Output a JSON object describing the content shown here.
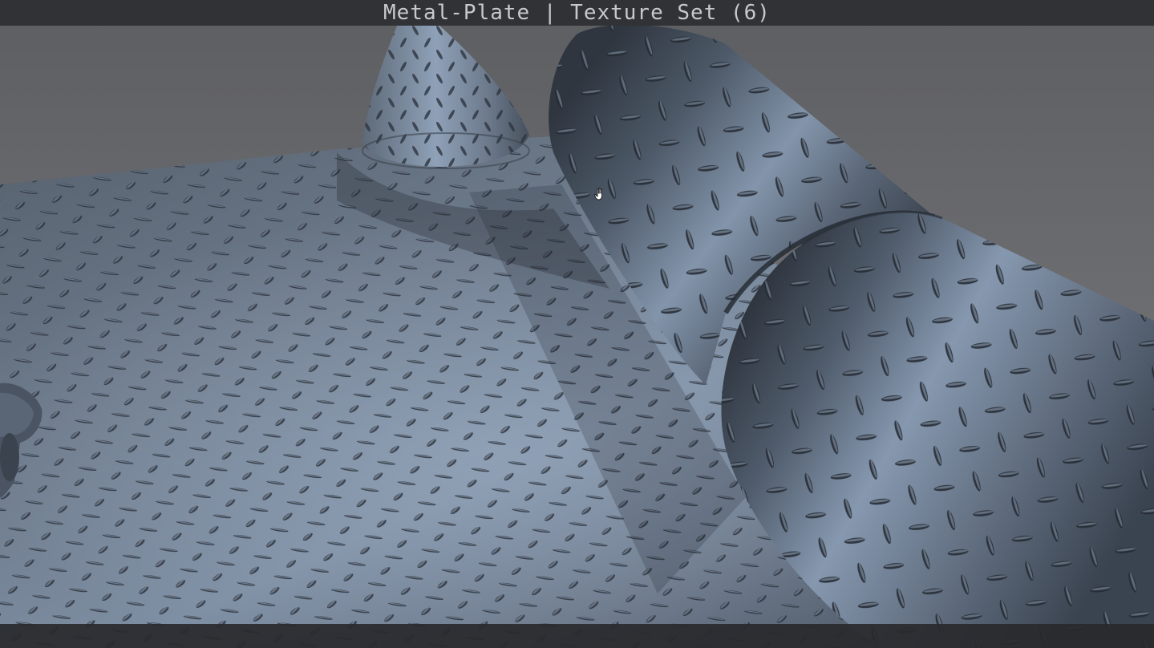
{
  "window": {
    "title": "Metal-Plate | Texture Set (6)"
  },
  "viewport": {
    "material": "Metal-Plate",
    "objects": [
      "floor-plane",
      "cone",
      "cylinder-bent-segment",
      "cylinder-front-segment",
      "torus-fragment"
    ]
  },
  "cursor": {
    "icon": "hand-grab-icon"
  },
  "colors": {
    "title_bar": "#313235",
    "title_text": "#c8c9cc",
    "background": "#6b6c6f",
    "metal_base": "#4a5565",
    "metal_highlight": "#8a9bb0",
    "tread": "#2b323b"
  }
}
